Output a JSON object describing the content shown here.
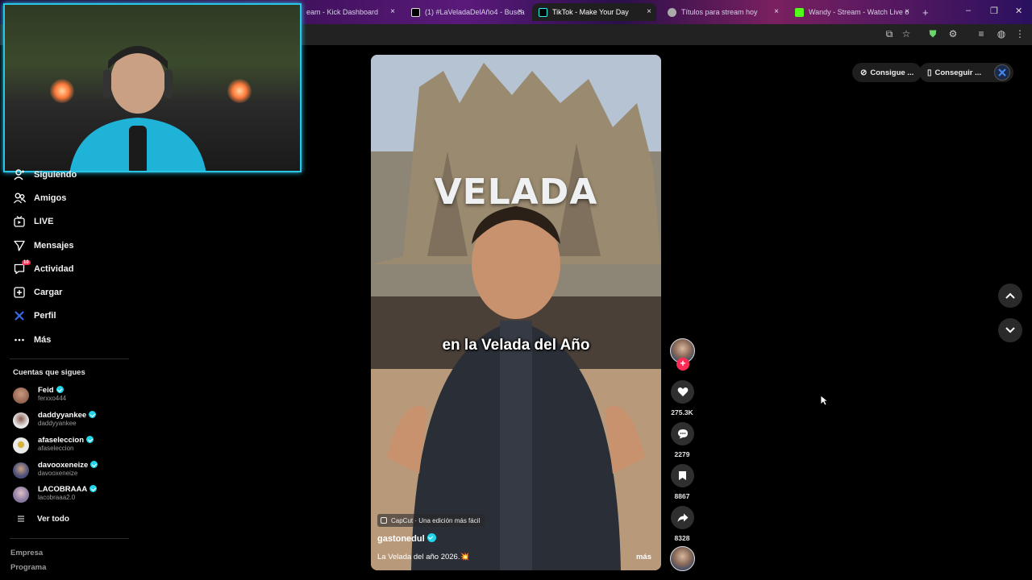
{
  "browser": {
    "tabs": [
      {
        "label": "eam - Kick Dashboard",
        "favicon_color": "#53fc18"
      },
      {
        "label": "(1) #LaVeladaDelAño4 - Busca",
        "favicon_color": "#000000"
      },
      {
        "label": "TikTok - Make Your Day",
        "favicon_color": "#000000"
      },
      {
        "label": "Títulos para stream hoy",
        "favicon_color": "#aaaaaa"
      },
      {
        "label": "Wandy - Stream - Watch Live o",
        "favicon_color": "#53fc18"
      }
    ],
    "new_tab": "+",
    "close_glyph": "×",
    "window_controls": [
      "–",
      "❐",
      "✕"
    ]
  },
  "sidebar": {
    "nav": [
      {
        "label": "Siguiendo",
        "icon": "following-icon"
      },
      {
        "label": "Amigos",
        "icon": "friends-icon"
      },
      {
        "label": "LIVE",
        "icon": "live-icon"
      },
      {
        "label": "Mensajes",
        "icon": "messages-icon"
      },
      {
        "label": "Actividad",
        "icon": "activity-icon",
        "badge": "10"
      },
      {
        "label": "Cargar",
        "icon": "upload-icon"
      },
      {
        "label": "Perfil",
        "icon": "profile-icon"
      },
      {
        "label": "Más",
        "icon": "more-icon"
      }
    ],
    "following_title": "Cuentas que sigues",
    "accounts": [
      {
        "name": "Feid",
        "handle": "ferxxo444",
        "verified": true,
        "avatar_color": "#7a4a3a"
      },
      {
        "name": "daddyyankee",
        "handle": "daddyyankee",
        "verified": true,
        "avatar_color": "#cfcfcf"
      },
      {
        "name": "afaseleccion",
        "handle": "afaseleccion",
        "verified": true,
        "avatar_color": "#e8e8e8"
      },
      {
        "name": "davooxeneize",
        "handle": "davooxeneize",
        "verified": true,
        "avatar_color": "#4a4f7a"
      },
      {
        "name": "LACOBRAAA",
        "handle": "lacobraaa2.0",
        "verified": true,
        "avatar_color": "#8a7aa0"
      }
    ],
    "see_all": "Ver todo",
    "footer": [
      "Empresa",
      "Programa"
    ]
  },
  "header": {
    "pill_1": "Consigue ...",
    "pill_2": "Conseguir ..."
  },
  "video": {
    "overlay_title": "VELADA",
    "caption": "en la Velada del Año",
    "capcut_label": "CapCut · Una edición más fácil",
    "author": "gastonedul",
    "description": "La Velada del año 2026.💥",
    "more": "más"
  },
  "actions": {
    "likes": "275.3K",
    "comments": "2279",
    "saves": "8867",
    "shares": "8328"
  },
  "colors": {
    "accent": "#fe2c55",
    "verified": "#20d5ec",
    "webcam_border": "#29c6e8"
  }
}
